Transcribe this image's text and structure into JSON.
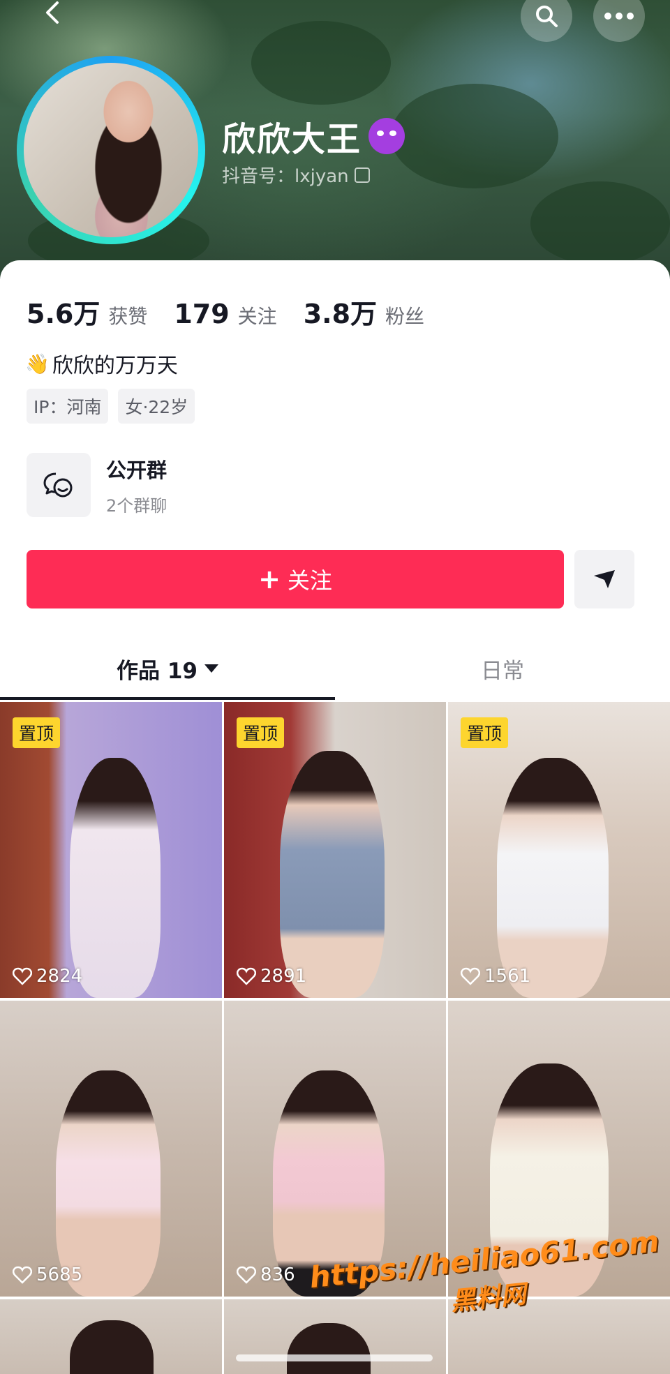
{
  "profile": {
    "name": "欣欣大王",
    "handle": "抖音号：lxjyan"
  },
  "stats": [
    {
      "value": "5.6万",
      "label": "获赞"
    },
    {
      "value": "179",
      "label": "关注"
    },
    {
      "value": "3.8万",
      "label": "粉丝"
    }
  ],
  "bio": "欣欣的万万天",
  "tags": [
    "IP：河南",
    "女·22岁"
  ],
  "group": {
    "title": "公开群",
    "subtitle": "2个群聊"
  },
  "actions": {
    "follow_label": "关注",
    "follow_plus": "+"
  },
  "tabs": {
    "works_label": "作品 19",
    "daily_label": "日常"
  },
  "videos": [
    {
      "pinned_label": "置顶",
      "likes": "2824"
    },
    {
      "pinned_label": "置顶",
      "likes": "2891"
    },
    {
      "pinned_label": "置顶",
      "likes": "1561"
    },
    {
      "pinned_label": "",
      "likes": "5685"
    },
    {
      "pinned_label": "",
      "likes": "836"
    },
    {
      "pinned_label": "",
      "likes": ""
    }
  ],
  "watermark": {
    "url": "https://heiliao61.com",
    "cn": "黑料网"
  },
  "colors": {
    "accent": "#fe2c55",
    "pin": "#fdd52e",
    "ring": "#25f4ee"
  }
}
